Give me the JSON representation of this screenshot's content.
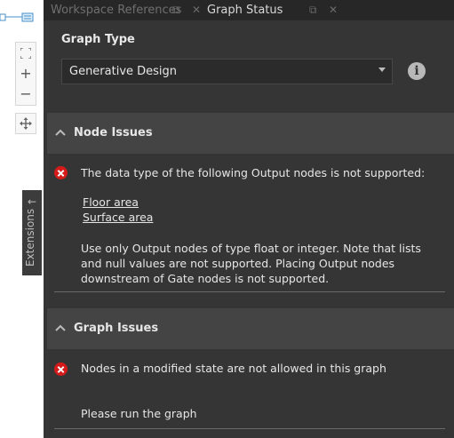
{
  "tabs": [
    {
      "label": "Workspace References"
    },
    {
      "label": "Graph Status"
    }
  ],
  "canvas": {
    "extensions_label": "Extensions"
  },
  "graph_type": {
    "label": "Graph Type",
    "selected": "Generative Design"
  },
  "node_issues": {
    "title": "Node Issues",
    "message": "The data type of the following Output nodes is not supported:",
    "links": [
      "Floor area",
      "Surface area"
    ],
    "detail": "Use only Output nodes of type float or integer. Note that lists and null values are not supported. Placing Output nodes downstream of Gate nodes is not supported."
  },
  "graph_issues": {
    "title": "Graph Issues",
    "message": "Nodes in a modified state are not allowed in this graph",
    "detail": "Please run the graph"
  },
  "colors": {
    "error": "#d51a1a",
    "panel_bg": "#353535",
    "header_bg": "#444444",
    "tabbar_bg": "#272727"
  }
}
